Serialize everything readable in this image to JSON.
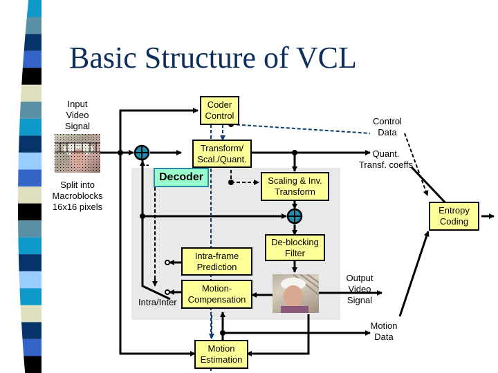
{
  "title": "Basic Structure of VCL",
  "stripe_colors": [
    "#0e9ac8",
    "#5a8fa6",
    "#06336a",
    "#3464c8",
    "#000000",
    "#e0e0c0",
    "#5a8fa6",
    "#0e9ac8",
    "#06336a",
    "#99ccff",
    "#3464c8",
    "#e0e0c0",
    "#000000",
    "#5a8fa6",
    "#0e9ac8",
    "#06336a",
    "#99ccff",
    "#0e9ac8",
    "#e0e0c0",
    "#06336a",
    "#3464c8",
    "#000000"
  ],
  "labels": {
    "input_video_signal": [
      "Input",
      "Video",
      "Signal"
    ],
    "split_into_macroblocks": [
      "Split into",
      "Macroblocks",
      "16x16 pixels"
    ],
    "control_data": [
      "Control",
      "Data"
    ],
    "quant_transf_coeffs": [
      "Quant.",
      "Transf. coeffs"
    ],
    "output_video_signal": [
      "Output",
      "Video",
      "Signal"
    ],
    "motion_data": [
      "Motion",
      "Data"
    ],
    "intra_inter": "Intra/Inter",
    "minus_sign": "-"
  },
  "blocks": {
    "coder_control": [
      "Coder",
      "Control"
    ],
    "transform_scal_quant": [
      "Transform/",
      "Scal./Quant."
    ],
    "decoder": "Decoder",
    "scaling_inv_transform": [
      "Scaling & Inv.",
      "Transform"
    ],
    "entropy_coding": [
      "Entropy",
      "Coding"
    ],
    "deblocking_filter": [
      "De-blocking",
      "Filter"
    ],
    "intra_frame_prediction": [
      "Intra-frame",
      "Prediction"
    ],
    "motion_compensation": [
      "Motion-",
      "Compensation"
    ],
    "motion_estimation": [
      "Motion",
      "Estimation"
    ]
  },
  "colors": {
    "title": "#0d2e5c",
    "block_fill": "#ffff99",
    "decoder_fill": "#99ffcc",
    "decoder_border": "#2a8aa0",
    "decoder_region": "#e9e9e9",
    "adder_fill": "#1f8fb0",
    "control_dash": "#0d3d6e"
  }
}
